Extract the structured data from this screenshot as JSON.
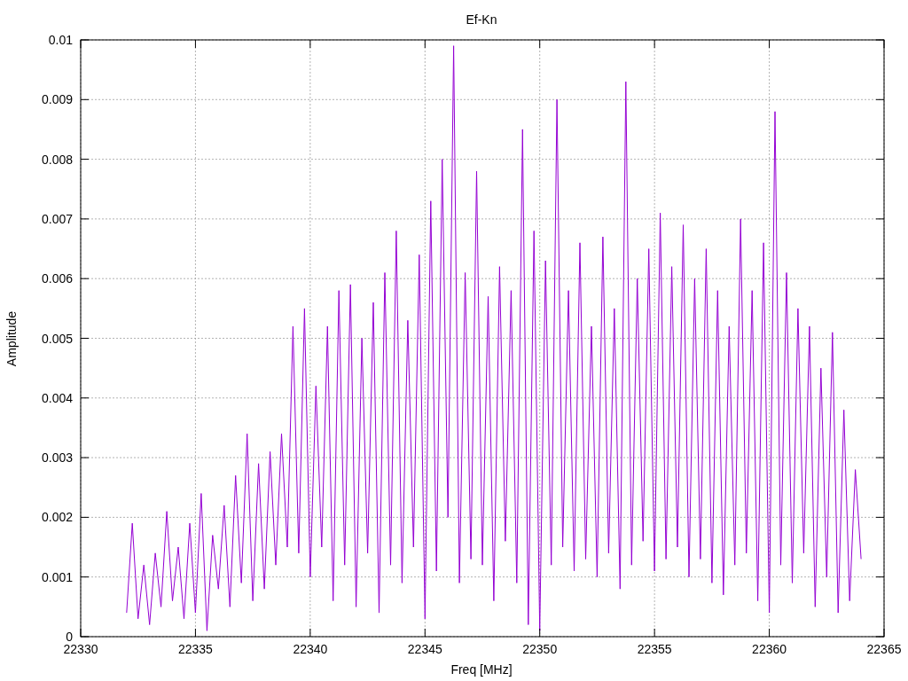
{
  "chart_data": {
    "type": "line",
    "title": "Ef-Kn",
    "xlabel": "Freq [MHz]",
    "ylabel": "Amplitude",
    "xlim": [
      22330,
      22365
    ],
    "ylim": [
      0,
      0.01
    ],
    "grid": true,
    "xticks": [
      22330,
      22335,
      22340,
      22345,
      22350,
      22355,
      22360,
      22365
    ],
    "yticks": [
      0,
      0.001,
      0.002,
      0.003,
      0.004,
      0.005,
      0.006,
      0.007,
      0.008,
      0.009,
      0.01
    ],
    "x": [
      22332,
      22332.25,
      22332.5,
      22332.75,
      22333,
      22333.25,
      22333.5,
      22333.75,
      22334,
      22334.25,
      22334.5,
      22334.75,
      22335,
      22335.25,
      22335.5,
      22335.75,
      22336,
      22336.25,
      22336.5,
      22336.75,
      22337,
      22337.25,
      22337.5,
      22337.75,
      22338,
      22338.25,
      22338.5,
      22338.75,
      22339,
      22339.25,
      22339.5,
      22339.75,
      22340,
      22340.25,
      22340.5,
      22340.75,
      22341,
      22341.25,
      22341.5,
      22341.75,
      22342,
      22342.25,
      22342.5,
      22342.75,
      22343,
      22343.25,
      22343.5,
      22343.75,
      22344,
      22344.25,
      22344.5,
      22344.75,
      22345,
      22345.25,
      22345.5,
      22345.75,
      22346,
      22346.25,
      22346.5,
      22346.75,
      22347,
      22347.25,
      22347.5,
      22347.75,
      22348,
      22348.25,
      22348.5,
      22348.75,
      22349,
      22349.25,
      22349.5,
      22349.75,
      22350,
      22350.25,
      22350.5,
      22350.75,
      22351,
      22351.25,
      22351.5,
      22351.75,
      22352,
      22352.25,
      22352.5,
      22352.75,
      22353,
      22353.25,
      22353.5,
      22353.75,
      22354,
      22354.25,
      22354.5,
      22354.75,
      22355,
      22355.25,
      22355.5,
      22355.75,
      22356,
      22356.25,
      22356.5,
      22356.75,
      22357,
      22357.25,
      22357.5,
      22357.75,
      22358,
      22358.25,
      22358.5,
      22358.75,
      22359,
      22359.25,
      22359.5,
      22359.75,
      22360,
      22360.25,
      22360.5,
      22360.75,
      22361,
      22361.25,
      22361.5,
      22361.75,
      22362,
      22362.25,
      22362.5,
      22362.75,
      22363,
      22363.25,
      22363.5,
      22363.75,
      22364
    ],
    "series": [
      {
        "color": "#9400d3",
        "values": [
          0.0004,
          0.0019,
          0.0003,
          0.0012,
          0.0002,
          0.0014,
          0.0005,
          0.0021,
          0.0006,
          0.0015,
          0.0003,
          0.0019,
          0.0004,
          0.0024,
          0.0001,
          0.0017,
          0.0008,
          0.0022,
          0.0005,
          0.0027,
          0.0009,
          0.0034,
          0.0006,
          0.0029,
          0.0008,
          0.0031,
          0.0012,
          0.0034,
          0.0015,
          0.0052,
          0.0014,
          0.0055,
          0.001,
          0.0042,
          0.0015,
          0.0052,
          0.0006,
          0.0058,
          0.0012,
          0.0059,
          0.0005,
          0.005,
          0.0014,
          0.0056,
          0.0004,
          0.0061,
          0.0012,
          0.0068,
          0.0009,
          0.0053,
          0.0015,
          0.0064,
          0.0003,
          0.0073,
          0.0011,
          0.008,
          0.002,
          0.0099,
          0.0009,
          0.0061,
          0.0013,
          0.0078,
          0.0012,
          0.0057,
          0.0006,
          0.0062,
          0.0016,
          0.0058,
          0.0009,
          0.0085,
          0.0002,
          0.0068,
          0.0001,
          0.0063,
          0.0012,
          0.009,
          0.0015,
          0.0058,
          0.0011,
          0.0066,
          0.0013,
          0.0052,
          0.001,
          0.0067,
          0.0014,
          0.0055,
          0.0008,
          0.0093,
          0.0012,
          0.006,
          0.0016,
          0.0065,
          0.0011,
          0.0071,
          0.0013,
          0.0062,
          0.0015,
          0.0069,
          0.001,
          0.006,
          0.0013,
          0.0065,
          0.0009,
          0.0058,
          0.0007,
          0.0052,
          0.0012,
          0.007,
          0.0014,
          0.0058,
          0.0006,
          0.0066,
          0.0004,
          0.0088,
          0.0012,
          0.0061,
          0.0009,
          0.0055,
          0.0014,
          0.0052,
          0.0005,
          0.0045,
          0.001,
          0.0051,
          0.0004,
          0.0038,
          0.0006,
          0.0028,
          0.0013
        ]
      }
    ]
  }
}
